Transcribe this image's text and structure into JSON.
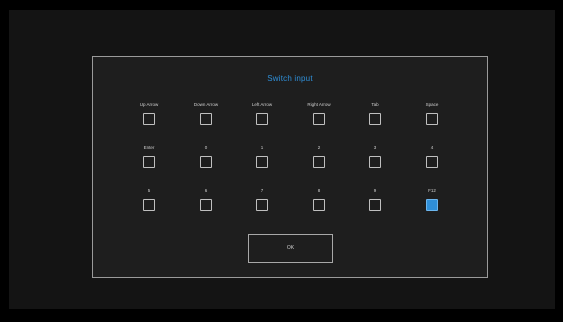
{
  "colors": {
    "background": "#000000",
    "accent": "#2f8fd8",
    "text": "#d0d0d0",
    "title": "#2f8fd8"
  },
  "dialog": {
    "title": "Switch input",
    "ok_label": "OK"
  },
  "keys": [
    {
      "label": "Up Arrow",
      "checked": false
    },
    {
      "label": "Down Arrow",
      "checked": false
    },
    {
      "label": "Left Arrow",
      "checked": false
    },
    {
      "label": "Right Arrow",
      "checked": false
    },
    {
      "label": "Tab",
      "checked": false
    },
    {
      "label": "Space",
      "checked": false
    },
    {
      "label": "Enter",
      "checked": false
    },
    {
      "label": "0",
      "checked": false
    },
    {
      "label": "1",
      "checked": false
    },
    {
      "label": "2",
      "checked": false
    },
    {
      "label": "3",
      "checked": false
    },
    {
      "label": "4",
      "checked": false
    },
    {
      "label": "5",
      "checked": false
    },
    {
      "label": "6",
      "checked": false
    },
    {
      "label": "7",
      "checked": false
    },
    {
      "label": "8",
      "checked": false
    },
    {
      "label": "9",
      "checked": false
    },
    {
      "label": "F12",
      "checked": true
    }
  ]
}
